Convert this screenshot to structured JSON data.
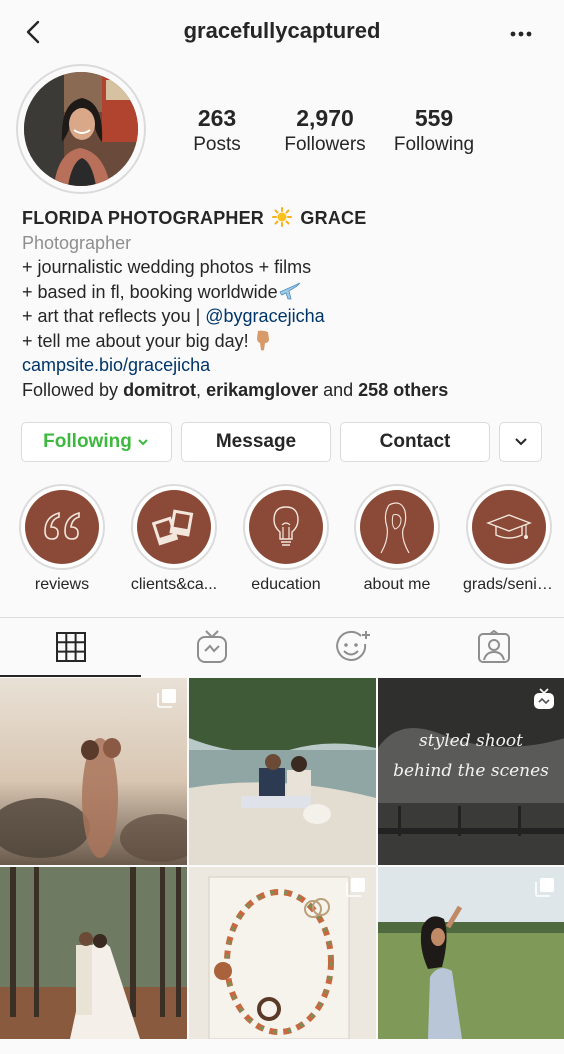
{
  "header": {
    "username": "gracefullycaptured"
  },
  "stats": [
    {
      "value": "263",
      "label": "Posts"
    },
    {
      "value": "2,970",
      "label": "Followers"
    },
    {
      "value": "559",
      "label": "Following"
    }
  ],
  "bio": {
    "name_part1": "FLORIDA PHOTOGRAPHER",
    "name_part2": "GRACE",
    "category": "Photographer",
    "line1": "+ journalistic wedding photos + films",
    "line2": "+ based in fl, booking worldwide",
    "line3_prefix": "+ art that reflects you | ",
    "line3_handle": "@bygracejicha",
    "line4": "+ tell me about your big day!",
    "link": "campsite.bio/gracejicha",
    "followed_by_prefix": "Followed by ",
    "followed_by_user1": "domitrot",
    "followed_by_sep": ", ",
    "followed_by_user2": "erikamglover",
    "followed_by_and": " and ",
    "followed_by_others": "258 others"
  },
  "actions": {
    "following_label": "Following",
    "message_label": "Message",
    "contact_label": "Contact"
  },
  "highlights": [
    {
      "label": "reviews",
      "icon": "quote-icon"
    },
    {
      "label": "clients&ca...",
      "icon": "polaroid-icon"
    },
    {
      "label": "education",
      "icon": "lightbulb-icon"
    },
    {
      "label": "about me",
      "icon": "portrait-sketch-icon"
    },
    {
      "label": "grads/seniors",
      "icon": "graduation-cap-icon"
    }
  ],
  "tabs": [
    "grid-icon",
    "igtv-icon",
    "reels-face-icon",
    "tagged-icon"
  ],
  "posts": {
    "overlay_text_line1": "styled shoot",
    "overlay_text_line2": "behind the scenes"
  },
  "colors": {
    "following_green": "#3fb83f",
    "link_blue": "#003569",
    "highlight_brown": "#8b4a38"
  }
}
